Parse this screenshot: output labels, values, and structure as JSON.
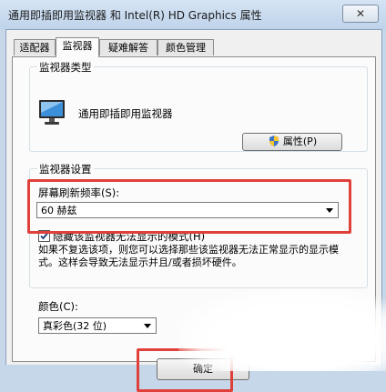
{
  "window": {
    "title": "通用即插即用监视器 和 Intel(R) HD Graphics 属性",
    "close_glyph": "✕"
  },
  "tabs": [
    {
      "label": "适配器",
      "active": false
    },
    {
      "label": "监视器",
      "active": true
    },
    {
      "label": "疑难解答",
      "active": false
    },
    {
      "label": "颜色管理",
      "active": false
    }
  ],
  "monitor_type": {
    "group_title": "监视器类型",
    "icon": "monitor-icon",
    "name": "通用即插即用监视器",
    "properties_button": "属性(P)",
    "properties_icon": "uac-shield-icon"
  },
  "monitor_settings": {
    "group_title": "监视器设置",
    "refresh_label": "屏幕刷新频率(S):",
    "refresh_value": "60 赫兹",
    "hide_modes_label": "隐藏该监视器无法显示的模式(H)",
    "hide_modes_checked": true,
    "hide_modes_note": "如果不复选该项，则您可以选择那些该监视器无法正常显示的显示模式。这样会导致无法显示并且/或者损坏硬件。",
    "color_label": "颜色(C):",
    "color_value": "真彩色(32 位)"
  },
  "buttons": {
    "ok": "确定"
  },
  "colors": {
    "highlight": "#e0403a",
    "titlebar": "#c6d7ea"
  }
}
